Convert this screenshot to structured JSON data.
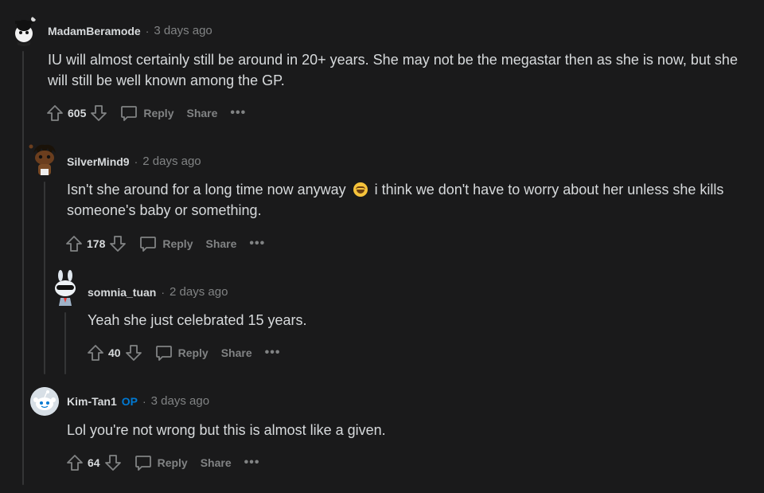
{
  "comments": [
    {
      "username": "MadamBeramode",
      "op": "",
      "time": "3 days ago",
      "body": "IU will almost certainly still be around in 20+ years. She may not be the megastar then as she is now, but she will still be well known among the GP.",
      "score": "605",
      "reply_label": "Reply",
      "share_label": "Share",
      "more_label": "•••"
    },
    {
      "username": "SilverMind9",
      "op": "",
      "time": "2 days ago",
      "body_before": "Isn't she around for a long time now anyway",
      "emoji": "grinning-sweat-emoji",
      "body_after": "i think we don't have to worry about her unless she kills someone's baby or something.",
      "score": "178",
      "reply_label": "Reply",
      "share_label": "Share",
      "more_label": "•••"
    },
    {
      "username": "somnia_tuan",
      "op": "",
      "time": "2 days ago",
      "body": "Yeah she just celebrated 15 years.",
      "score": "40",
      "reply_label": "Reply",
      "share_label": "Share",
      "more_label": "•••"
    },
    {
      "username": "Kim-Tan1",
      "op": "OP",
      "time": "3 days ago",
      "body": "Lol you're not wrong but this is almost like a given.",
      "score": "64",
      "reply_label": "Reply",
      "share_label": "Share",
      "more_label": "•••"
    }
  ],
  "separator": "·",
  "icons": {
    "upvote": "upvote-arrow-icon",
    "downvote": "downvote-arrow-icon",
    "reply": "speech-bubble-icon",
    "more": "ellipsis-icon"
  },
  "colors": {
    "background": "#1a1a1b",
    "text": "#d7dadc",
    "muted": "#818384",
    "op": "#0079d3",
    "thread_line": "#343536"
  }
}
